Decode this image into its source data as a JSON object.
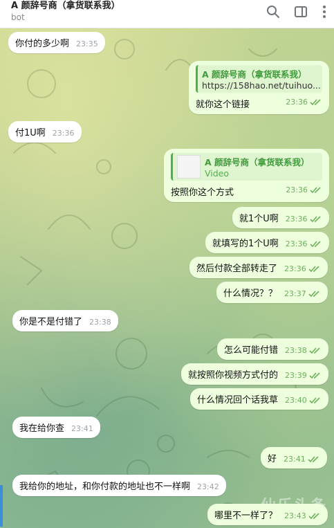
{
  "header": {
    "title": "A 颜辞号商（拿货联系我）",
    "subtitle": "bot",
    "icons": [
      "search-icon",
      "sidebar-toggle-icon",
      "more-vertical-icon"
    ]
  },
  "messages": [
    {
      "dir": "in",
      "text": "你付的多少啊",
      "time": "23:35"
    },
    {
      "dir": "out",
      "quote_title": "A 颜辞号商（拿货联系我）",
      "quote_body": "https://158hao.net/tuihuo...",
      "text": "就你这个链接",
      "time": "23:36"
    },
    {
      "dir": "in",
      "text": "付1U啊",
      "time": "23:36"
    },
    {
      "dir": "out",
      "quote_title": "A 颜辞号商（拿货联系我）",
      "quote_body": "Video",
      "text": "按照你这个方式",
      "time": "23:36"
    },
    {
      "dir": "out",
      "text": "就1个U啊",
      "time": "23:36"
    },
    {
      "dir": "out",
      "text": "就填写的1个U啊",
      "time": "23:36"
    },
    {
      "dir": "out",
      "text": "然后付款全部转走了",
      "time": "23:36"
    },
    {
      "dir": "out",
      "text": "什么情况？？",
      "time": "23:37"
    },
    {
      "dir": "in",
      "text": "你是不是付错了",
      "time": "23:38"
    },
    {
      "dir": "out",
      "text": "怎么可能付错",
      "time": "23:38"
    },
    {
      "dir": "out",
      "text": "就按照你视频方式付的",
      "time": "23:39"
    },
    {
      "dir": "out",
      "text": "什么情况回个话我草",
      "time": "23:40"
    },
    {
      "dir": "in",
      "text": "我在给你查",
      "time": "23:41"
    },
    {
      "dir": "out",
      "text": "好",
      "time": "23:41"
    },
    {
      "dir": "in",
      "text": "我给你的地址，和你付款的地址也不一样啊",
      "time": "23:42"
    },
    {
      "dir": "out",
      "text": "哪里不一样了？",
      "time": "23:43"
    }
  ],
  "watermark": "仙乐头条",
  "colors": {
    "incoming": "#ffffff",
    "outgoing": "#eeffde",
    "accent": "#4fae4e",
    "time_out": "#6bb05a"
  }
}
